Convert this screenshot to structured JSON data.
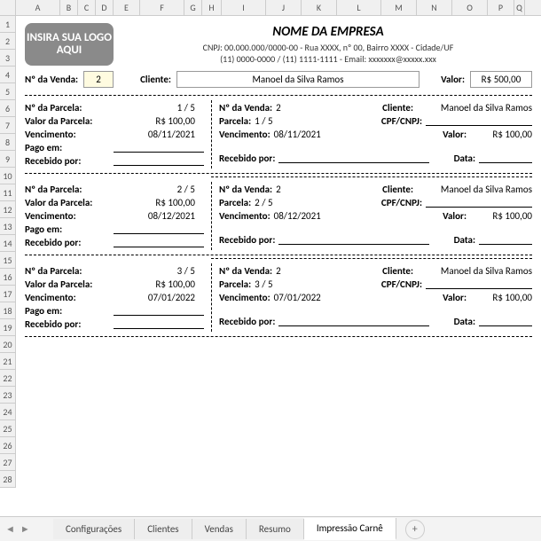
{
  "columns": [
    "A",
    "B",
    "C",
    "D",
    "E",
    "F",
    "G",
    "H",
    "I",
    "J",
    "K",
    "L",
    "M",
    "N",
    "O",
    "P",
    "Q"
  ],
  "rows": [
    "1",
    "2",
    "3",
    "4",
    "5",
    "6",
    "7",
    "8",
    "9",
    "10",
    "11",
    "12",
    "13",
    "14",
    "15",
    "16",
    "17",
    "18",
    "19",
    "20",
    "21",
    "22",
    "23",
    "24",
    "25",
    "26",
    "27",
    "28"
  ],
  "logo_text": "INSIRA SUA LOGO AQUI",
  "company": {
    "name": "NOME DA EMPRESA",
    "line1": "CNPJ: 00.000.000/0000-00 - Rua XXXX, nº 00, Bairro XXXX - Cidade/UF",
    "line2": "(11) 0000-0000 / (11) 1111-1111 - Email: xxxxxxx@xxxxx.xxx"
  },
  "sale_bar": {
    "num_label": "Nº da Venda:",
    "num_value": "2",
    "client_label": "Cliente:",
    "client_value": "Manoel da Silva Ramos",
    "valor_label": "Valor:",
    "valor_value": "R$ 500,00"
  },
  "labels": {
    "parcela_num": "Nº da Parcela:",
    "parcela_valor": "Valor da Parcela:",
    "vencimento": "Vencimento:",
    "pago_em": "Pago em:",
    "recebido_por": "Recebido por:",
    "venda_num": "Nº da Venda:",
    "cliente": "Cliente:",
    "parcela": "Parcela:",
    "cpf": "CPF/CNPJ:",
    "valor": "Valor:",
    "data": "Data:"
  },
  "parcelas": [
    {
      "num": "1 / 5",
      "valor": "R$ 100,00",
      "venc": "08/11/2021",
      "venda": "2",
      "cliente": "Manoel da Silva Ramos",
      "rvalor": "R$ 100,00"
    },
    {
      "num": "2 / 5",
      "valor": "R$ 100,00",
      "venc": "08/12/2021",
      "venda": "2",
      "cliente": "Manoel da Silva Ramos",
      "rvalor": "R$ 100,00"
    },
    {
      "num": "3 / 5",
      "valor": "R$ 100,00",
      "venc": "07/01/2022",
      "venda": "2",
      "cliente": "Manoel da Silva Ramos",
      "rvalor": "R$ 100,00"
    }
  ],
  "tabs": {
    "t1": "Configurações",
    "t2": "Clientes",
    "t3": "Vendas",
    "t4": "Resumo",
    "t5": "Impressão Carnê"
  }
}
